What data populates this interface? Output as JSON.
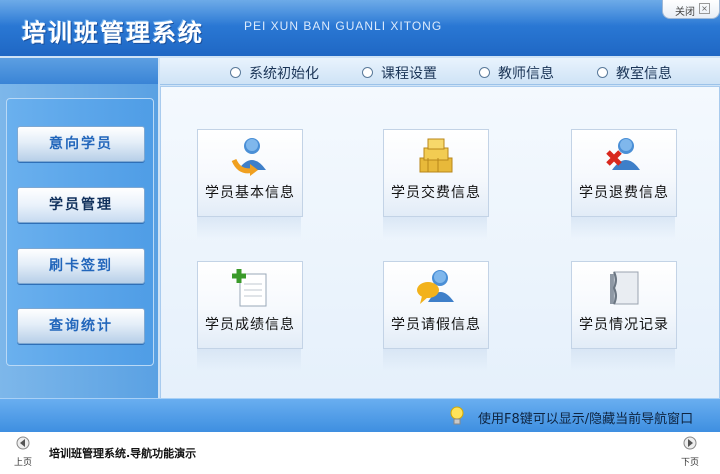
{
  "window": {
    "title": "培训班管理系统",
    "subtitle": "PEI XUN BAN GUANLI XITONG",
    "close_label": "关闭"
  },
  "top_nav": [
    {
      "label": "系统初始化"
    },
    {
      "label": "课程设置"
    },
    {
      "label": "教师信息"
    },
    {
      "label": "教室信息"
    }
  ],
  "sidebar": {
    "items": [
      {
        "label": "意向学员",
        "active": false
      },
      {
        "label": "学员管理",
        "active": true
      },
      {
        "label": "刷卡签到",
        "active": false
      },
      {
        "label": "查询统计",
        "active": false
      }
    ]
  },
  "cards": [
    {
      "label": "学员基本信息",
      "icon": "user-refresh-icon"
    },
    {
      "label": "学员交费信息",
      "icon": "gold-bars-icon"
    },
    {
      "label": "学员退费信息",
      "icon": "user-remove-icon"
    },
    {
      "label": "学员成绩信息",
      "icon": "add-document-icon"
    },
    {
      "label": "学员请假信息",
      "icon": "user-chat-icon"
    },
    {
      "label": "学员情况记录",
      "icon": "notebook-icon"
    }
  ],
  "status": {
    "tip": "使用F8键可以显示/隐藏当前导航窗口",
    "icon": "lightbulb-icon"
  },
  "footer": {
    "prev_label": "上页",
    "next_label": "下页",
    "caption": "培训班管理系统.导航功能演示"
  },
  "colors": {
    "header_blue": "#2a78d4",
    "accent_text": "#2266bb"
  }
}
